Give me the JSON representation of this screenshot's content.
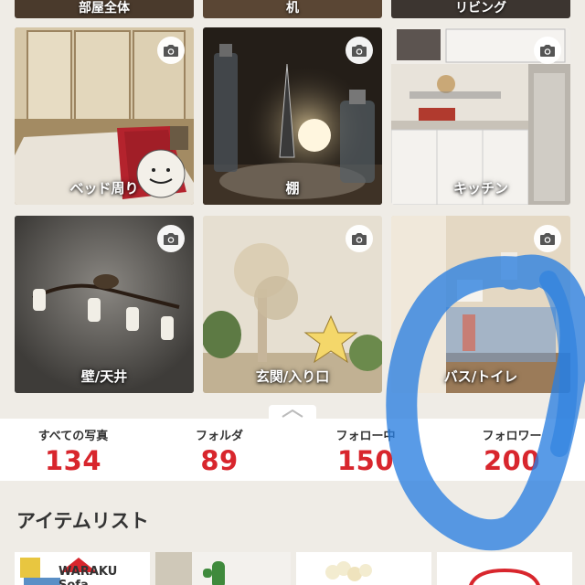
{
  "folders_top": [
    {
      "label": "部屋全体"
    },
    {
      "label": "机"
    },
    {
      "label": "リビング"
    }
  ],
  "folders": [
    {
      "label": "ベッド周り",
      "icon": "camera-icon"
    },
    {
      "label": "棚",
      "icon": "camera-icon"
    },
    {
      "label": "キッチン",
      "icon": "camera-icon"
    },
    {
      "label": "壁/天井",
      "icon": "camera-icon"
    },
    {
      "label": "玄関/入り口",
      "icon": "camera-icon"
    },
    {
      "label": "バス/トイレ",
      "icon": "camera-icon"
    }
  ],
  "stats": [
    {
      "label": "すべての写真",
      "value": "134"
    },
    {
      "label": "フォルダ",
      "value": "89"
    },
    {
      "label": "フォロー中",
      "value": "150"
    },
    {
      "label": "フォロワー",
      "value": "200"
    }
  ],
  "items": {
    "title": "アイテムリスト",
    "thumbs": [
      {
        "text": "WARAKU Sofa"
      },
      {
        "text": ""
      },
      {
        "text": ""
      },
      {
        "text": ""
      }
    ]
  },
  "colors": {
    "accent": "#d8262d",
    "background": "#efece6",
    "annotation": "#2a7fe0"
  }
}
